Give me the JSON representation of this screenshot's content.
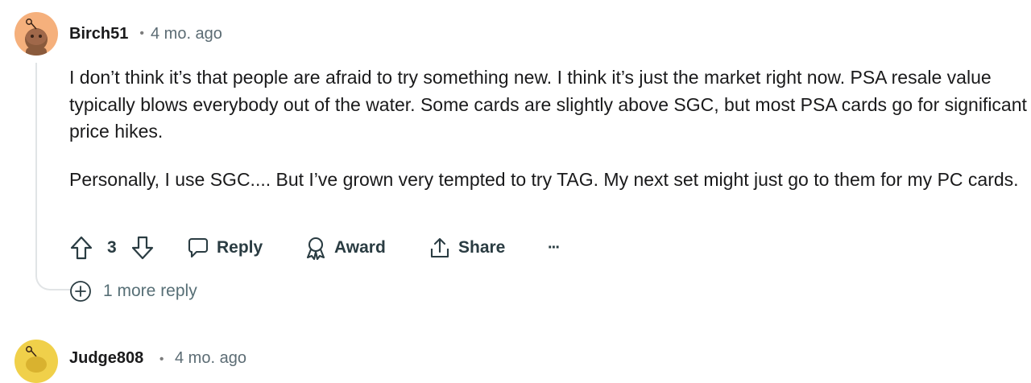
{
  "comment": {
    "username": "Birch51",
    "separator": "•",
    "time": "4 mo. ago",
    "paragraphs": [
      "I don’t think it’s that people are afraid to try something new. I think it’s just the market right now. PSA resale value typically blows everybody out of the water. Some cards are slightly above SGC, but most PSA cards go for significant price hikes.",
      "Personally, I use SGC.... But I’ve grown very tempted to try TAG. My next set might just go to them for my PC cards."
    ],
    "score": "3",
    "actions": {
      "reply": "Reply",
      "award": "Award",
      "share": "Share",
      "more": "···"
    },
    "more_replies": "1 more reply"
  },
  "next_comment": {
    "username": "Judge808",
    "separator": "•",
    "time": "4 mo. ago"
  },
  "colors": {
    "avatar_1": "#f5b07c",
    "avatar_2": "#f0d04a",
    "meta_text": "#5c6c74",
    "action_text": "#2a3c42"
  },
  "icons": [
    "snoo-avatar-icon",
    "upvote-icon",
    "downvote-icon",
    "comment-icon",
    "award-icon",
    "share-icon",
    "more-options-icon",
    "expand-plus-icon"
  ]
}
